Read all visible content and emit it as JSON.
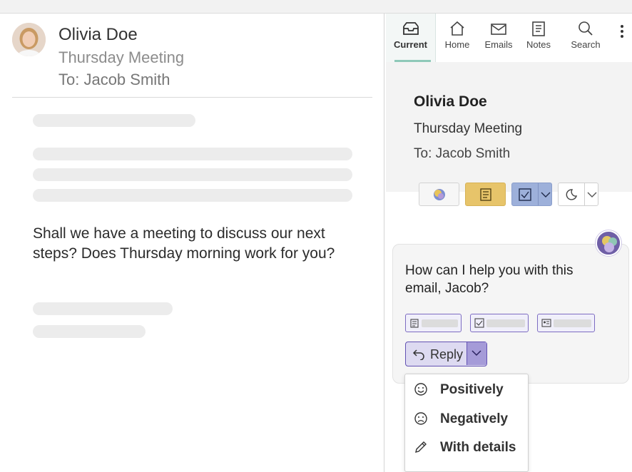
{
  "email": {
    "sender": "Olivia Doe",
    "subject": "Thursday Meeting",
    "to": "To: Jacob Smith",
    "body": "Shall we have a meeting to discuss our next steps? Does Thursday morning work for you?"
  },
  "pane": {
    "nav": [
      {
        "label": "Current",
        "icon": "inbox-icon",
        "active": true
      },
      {
        "label": "Home",
        "icon": "home-icon"
      },
      {
        "label": "Emails",
        "icon": "envelope-icon"
      },
      {
        "label": "Notes",
        "icon": "notes-icon"
      },
      {
        "label": "Search",
        "icon": "search-icon"
      }
    ],
    "header": {
      "name": "Olivia Doe",
      "subject": "Thursday Meeting",
      "to": "To: Jacob Smith"
    },
    "assistant": {
      "prompt": "How can I help you with this email, Jacob?",
      "reply_label": "Reply",
      "menu": [
        {
          "label": "Positively",
          "icon": "smile-icon"
        },
        {
          "label": "Negatively",
          "icon": "frown-icon"
        },
        {
          "label": "With details",
          "icon": "pencil-icon"
        }
      ]
    },
    "colors": {
      "accent": "#6352b3",
      "notes": "#e7c46a",
      "task": "#9db0da",
      "current_underline": "#8fc9b9"
    }
  }
}
